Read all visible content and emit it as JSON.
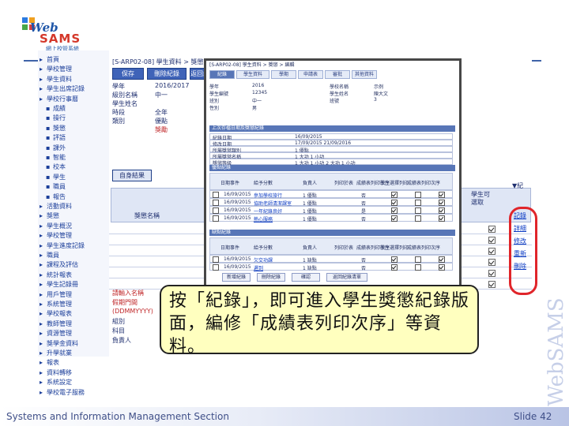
{
  "logo": {
    "web": "Web",
    "sams": "SAMS",
    "subtitle": "網上校管系統"
  },
  "watermark": "WebSAMS",
  "footer": {
    "left": "Systems and Information Management Section",
    "right": "Slide 42"
  },
  "nav": {
    "items": [
      "首頁",
      "學校管理",
      "學生資料",
      "學生出席記錄",
      "學校行事曆",
      "活動資料",
      "獎懲",
      "學生概況",
      "學校管理",
      "學生進度記錄",
      "職員",
      "課程及評估",
      "統計報表",
      "學生記錄冊",
      "用戶管理",
      "系統管理",
      "學校報表",
      "教師管理",
      "資源管理",
      "獎學金資料",
      "升學就業",
      "報表",
      "資料轉移",
      "系統設定",
      "學校電子服務"
    ],
    "sub_items": [
      "成績",
      "操行",
      "獎懲",
      "評語",
      "課外",
      "智能",
      "校本",
      "學生",
      "職員",
      "報告"
    ]
  },
  "background_page": {
    "title": "[S-ARP02-08] 學生資料 > 獎懲 > 編輯",
    "top_buttons": [
      "保存",
      "刪除紀錄",
      "返回紀錄清單"
    ],
    "fields": [
      [
        "學年",
        "2016/2017"
      ],
      [
        "級別名稱",
        "中一"
      ],
      [
        "學生姓名",
        ""
      ],
      [
        "時段",
        "全年"
      ],
      [
        "類別",
        "優點"
      ],
      [
        "",
        "獎勵"
      ]
    ],
    "section_button": "自身結果",
    "col_header_left": "獎懲名稱",
    "right_col_headers": [
      "學生可選取",
      "修改",
      "備註"
    ],
    "right_header_label": "▼紀",
    "right_links": [
      "記錄",
      "詳細",
      "修改",
      "重新",
      "刪除"
    ],
    "bottom_left_rows": [
      "請輸入名稱",
      "假期門間",
      "(DDMMYYYY)",
      "組別",
      "科目",
      "負責人"
    ]
  },
  "popup": {
    "title": "[S-ARP02-08] 學生資料 > 獎懲 > 編輯",
    "tabs": [
      "紀錄",
      "學生資料",
      "學期",
      "申請表",
      "審批",
      "其他資料"
    ],
    "info_rows": [
      [
        "學年",
        "2016",
        "學校名稱",
        "示例"
      ],
      [
        "學生編號",
        "12345",
        "學生姓名",
        "陳大文"
      ],
      [
        "班別",
        "中一",
        "班號",
        "3"
      ],
      [
        "性別",
        "男",
        "",
        ""
      ]
    ],
    "section1": "上次存檔日期及獎懲紀錄",
    "section1_rows": [
      [
        "紀錄日期",
        "16/09/2015"
      ],
      [
        "修改日期",
        "17/09/2015  21/09/2016"
      ],
      [
        "所屬獎懲類別",
        "1 優點"
      ],
      [
        "所屬獎懲名稱",
        "1 大功  1 小功"
      ],
      [
        "獎懲等級",
        "1 大功  1 小功  2 大功  1 小功"
      ]
    ],
    "section2": "優點紀錄",
    "table_headers": [
      "日期",
      "事件",
      "給予分數",
      "負責人",
      "列印於表",
      "成績表列印次序",
      "學生選擇列印",
      "成績表列印次序"
    ],
    "section2_rows": [
      [
        "16/09/2015",
        "參加學校旅行",
        "1 優點",
        "",
        "否"
      ],
      [
        "16/09/2015",
        "協助老師清潔課室",
        "1 優點",
        "",
        "否"
      ],
      [
        "16/09/2015",
        "一年紀錄良好",
        "1 優點",
        "",
        "是"
      ],
      [
        "16/09/2015",
        "熱心服務",
        "1 優點",
        "",
        "否"
      ]
    ],
    "section3": "缺點紀錄",
    "section3_rows": [
      [
        "16/09/2015",
        "欠交功課",
        "1 缺點",
        "",
        "否"
      ],
      [
        "16/09/2015",
        "遲到",
        "1 缺點",
        "",
        "否"
      ]
    ],
    "bottom_buttons": [
      "新增紀錄",
      "刪除紀錄",
      "確認",
      "返回紀錄清單"
    ]
  },
  "callout": {
    "text": "按「紀錄」，即可進入學生獎懲紀錄版面，編修「成績表列印次序」等資料。"
  },
  "colors": {
    "accent": "#3f63b8",
    "highlight_oval": "#e0252a",
    "callout_bg": "#ffffbf"
  }
}
